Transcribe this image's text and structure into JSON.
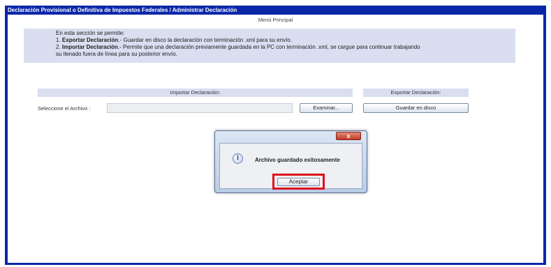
{
  "window": {
    "title": "Declaración Provisional o Definitiva de Impuestos Federales / Administrar Declaración"
  },
  "menu_link": "Menú Principal",
  "info": {
    "intro": "En esta sección se permite:",
    "item1_num": "1.",
    "item1_bold": "Exportar Declaración",
    "item1_text": ".- Guardar en disco la declaración con terminación .xml para su envío.",
    "item2_num": "2.",
    "item2_bold": "Importar Declaración",
    "item2_text": ".- Permite que una declaración previamente guardada en la PC con terminación .xml, se cargue para continuar trabajando",
    "item2_cont": "su llenado fuera de línea para su posterior envío."
  },
  "import_section": {
    "header": "Importar Declaración:",
    "file_label": "Seleccione el Archivo :",
    "file_value": "",
    "browse_label": "Examinar..."
  },
  "export_section": {
    "header": "Exportar Declaración:",
    "save_label": "Guardar en disco"
  },
  "dialog": {
    "close_glyph": "x",
    "icon": "info-icon",
    "message": "Archivo guardado exitosamente",
    "accept_label": "Aceptar",
    "highlight_color": "#e0101a"
  },
  "colors": {
    "frame": "#0b27a8",
    "panel": "#d9def0"
  }
}
